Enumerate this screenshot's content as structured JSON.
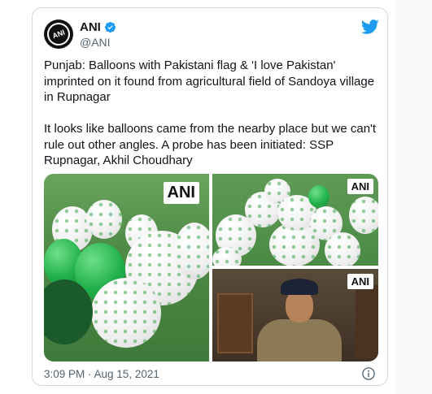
{
  "tweet": {
    "display_name": "ANI",
    "handle": "@ANI",
    "avatar_label": "ANI",
    "verified_icon": "verified-badge-icon",
    "platform_icon": "twitter-bird-icon",
    "text_paragraphs": [
      "Punjab: Balloons with Pakistani flag & 'I love Pakistan' imprinted on it found from agricultural field of Sandoya village in Rupnagar",
      "It looks like balloons came from the nearby place but we can't rule out other angles. A probe has been initiated: SSP Rupnagar, Akhil Choudhary"
    ],
    "media": {
      "photos": [
        {
          "watermark": "ANI"
        },
        {
          "watermark": "ANI"
        },
        {
          "watermark": "ANI"
        }
      ]
    },
    "timestamp": "3:09 PM · Aug 15, 2021",
    "info_icon": "info-icon"
  },
  "colors": {
    "twitter_blue": "#1d9bf0",
    "secondary_text": "#536471",
    "border": "#cfd9de"
  }
}
